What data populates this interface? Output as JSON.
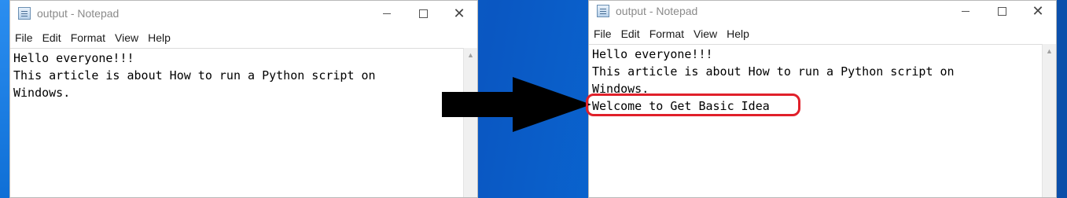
{
  "left_window": {
    "title": "output - Notepad",
    "menu": [
      "File",
      "Edit",
      "Format",
      "View",
      "Help"
    ],
    "lines": [
      "Hello everyone!!!",
      "This article is about How to run a Python script on",
      "Windows."
    ]
  },
  "right_window": {
    "title": "output - Notepad",
    "menu": [
      "File",
      "Edit",
      "Format",
      "View",
      "Help"
    ],
    "lines": [
      "Hello everyone!!!",
      "This article is about How to run a Python script on",
      "Windows.",
      "Welcome to Get Basic Idea"
    ]
  },
  "colors": {
    "highlight": "#e0202a",
    "arrow": "#000000",
    "desktop": "#0a57c2"
  }
}
